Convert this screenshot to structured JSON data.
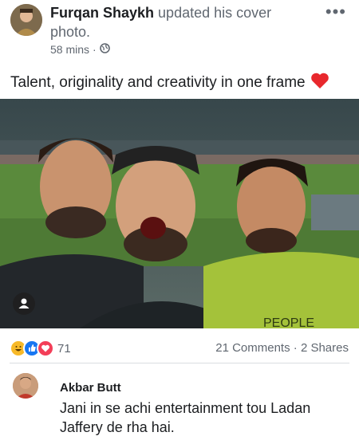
{
  "post": {
    "author": "Furqan Shaykh",
    "action": "updated his cover photo.",
    "time": "58 mins",
    "separator": "·",
    "privacy_icon": "globe-icon",
    "menu_icon": "more-dots-icon",
    "caption": "Talent, originality and creativity in one frame",
    "caption_emoji": "red-heart-emoji",
    "photo_text": "PEOPLE"
  },
  "engagement": {
    "reaction_icons": [
      "haha-icon",
      "like-icon",
      "love-icon"
    ],
    "reaction_count": "71",
    "comments": "21 Comments",
    "separator": "·",
    "shares": "2 Shares"
  },
  "comment": {
    "author": "Akbar Butt",
    "text": "Jani in se achi entertainment tou Ladan Jaffery de rha hai."
  },
  "colors": {
    "name": "#1c1e21",
    "secondary": "#606770",
    "like_blue": "#1877f2",
    "love_red": "#f33e58",
    "haha_yellow": "#f7b928",
    "pitch_green": "#5a8a3c"
  }
}
